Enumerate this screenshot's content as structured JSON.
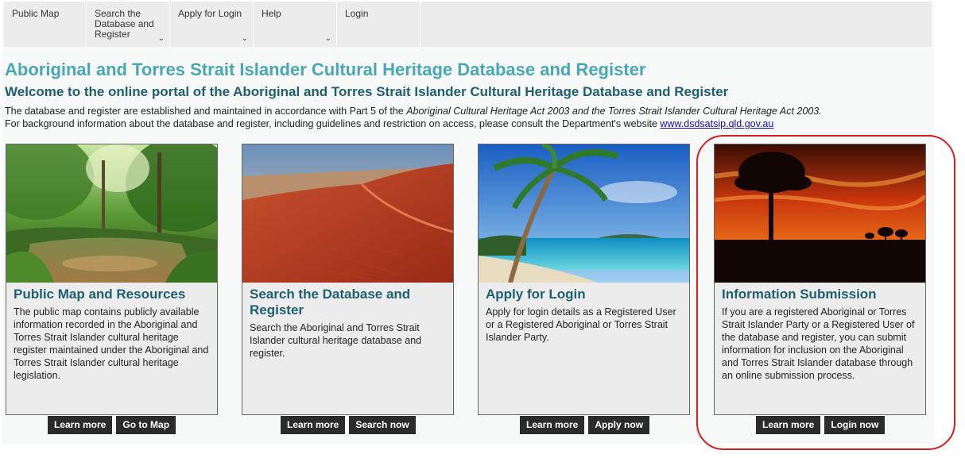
{
  "nav": {
    "items": [
      {
        "label": "Public Map",
        "has_menu": false
      },
      {
        "label": "Search the Database and Register",
        "has_menu": true
      },
      {
        "label": "Apply for Login",
        "has_menu": true
      },
      {
        "label": "Help",
        "has_menu": true
      },
      {
        "label": "Login",
        "has_menu": false
      }
    ],
    "chevron": "⌄"
  },
  "header": {
    "title": "Aboriginal and Torres Strait Islander Cultural Heritage Database and Register",
    "welcome": "Welcome to the online portal of the Aboriginal and Torres Strait Islander Cultural Heritage Database and Register",
    "intro_line1_start": "The database and register are established and maintained in accordance with Part 5 of the ",
    "intro_line1_italic": "Aboriginal Cultural Heritage Act 2003 and the Torres Strait Islander Cultural Heritage Act 2003.",
    "intro_line2_start": "For background information about the database and register, including guidelines and restriction on access, please consult the Department's website ",
    "intro_link": "www.dsdsatsip.qld.gov.au"
  },
  "cards": [
    {
      "image": "rainforest-creek-image",
      "title": "Public Map and Resources",
      "text": "The public map contains publicly available information recorded in the Aboriginal and Torres Strait Islander cultural heritage register maintained under the Aboriginal and Torres Strait Islander cultural heritage legislation.",
      "buttons": [
        "Learn more",
        "Go to Map"
      ]
    },
    {
      "image": "red-sand-dune-image",
      "title": "Search the Database and Register",
      "text": "Search the Aboriginal and Torres Strait Islander cultural heritage database and register.",
      "buttons": [
        "Learn more",
        "Search now"
      ]
    },
    {
      "image": "tropical-beach-palm-image",
      "title": "Apply for Login",
      "text": "Apply for login details as a Registered User or a Registered Aboriginal or Torres Strait Islander Party.",
      "buttons": [
        "Learn more",
        "Apply now"
      ]
    },
    {
      "image": "sunset-tree-silhouette-image",
      "title": "Information Submission",
      "text": "If you are a registered Aboriginal or Torres Strait Islander Party or a Registered User of the database and register, you can submit information for inclusion on the Aboriginal and Torres Strait Islander database through an online submission process.",
      "buttons": [
        "Learn more",
        "Login now"
      ]
    }
  ],
  "colors": {
    "title": "#48a8b4",
    "heading": "#1d5f71",
    "button_bg": "#2b2b2b",
    "highlight": "#d81d1d"
  }
}
